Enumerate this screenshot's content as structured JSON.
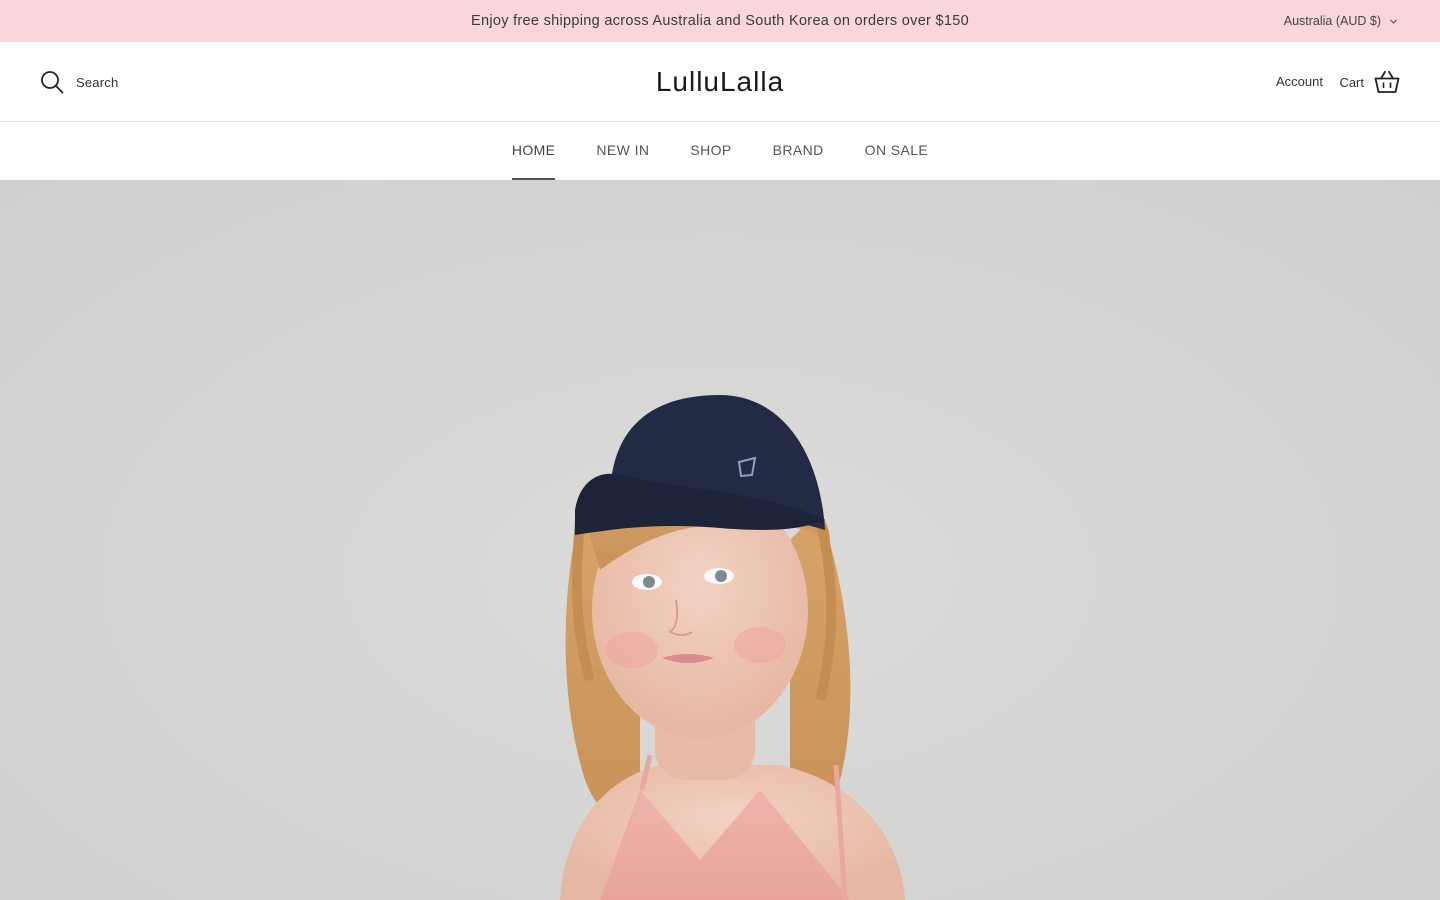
{
  "announcement": {
    "text": "Enjoy free shipping across Australia and South Korea on orders over $150",
    "background_color": "#f9d5dc"
  },
  "currency_selector": {
    "selected": "Australia (AUD $)",
    "icon": "chevron-down-icon"
  },
  "header": {
    "search_label": "Search",
    "search_icon": "search-icon",
    "logo_text": "LulluLalla",
    "account_label": "Account",
    "cart_label": "Cart",
    "cart_icon": "basket-icon"
  },
  "nav": {
    "items": [
      {
        "label": "HOME",
        "active": true
      },
      {
        "label": "NEW IN",
        "active": false
      },
      {
        "label": "SHOP",
        "active": false
      },
      {
        "label": "BRAND",
        "active": false
      },
      {
        "label": "ON SALE",
        "active": false
      }
    ]
  },
  "hero": {
    "image": "girl-in-navy-cap-photo",
    "background_color": "#d6d6d5"
  }
}
